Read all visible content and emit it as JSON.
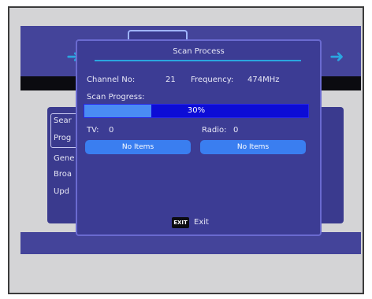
{
  "background_menu": {
    "items": [
      "Sear",
      "Prog",
      "Gene",
      "Broa",
      "Upd"
    ]
  },
  "dialog": {
    "title": "Scan Process",
    "channel_label": "Channel No:",
    "channel_value": "21",
    "frequency_label": "Frequency:",
    "frequency_value": "474MHz",
    "progress_label": "Scan Progress:",
    "progress_percent_text": "30%",
    "progress_fraction": 0.3,
    "tv_label": "TV:",
    "tv_count": "0",
    "radio_label": "Radio:",
    "radio_count": "0",
    "tv_result": "No Items",
    "radio_result": "No Items",
    "exit_key": "EXIT",
    "exit_label": "Exit"
  },
  "colors": {
    "dialog_bg": "#3c3c94",
    "progress_fill": "#4a8cf4",
    "progress_track": "#0c0cd6",
    "accent_line": "#2aa6e0",
    "pill": "#3a7ef0"
  },
  "icons": {
    "left_arrow": "left-arrow-icon",
    "right_arrow": "right-arrow-icon"
  }
}
